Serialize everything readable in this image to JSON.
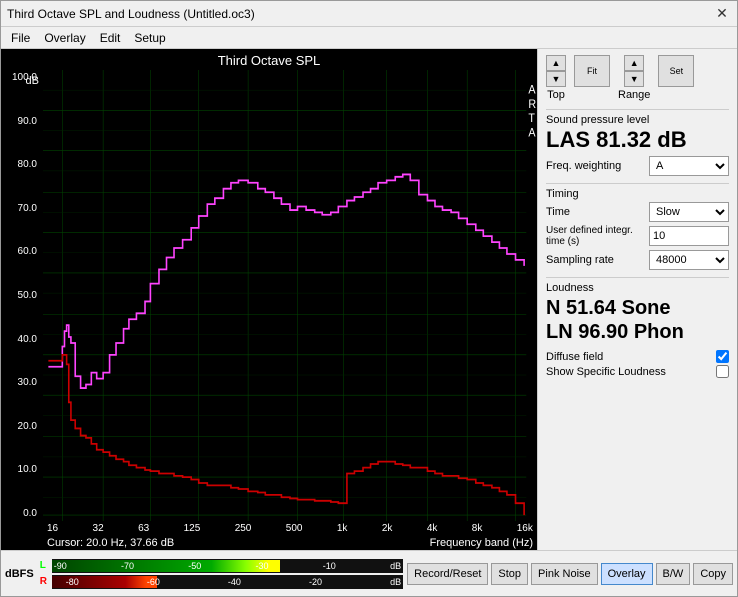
{
  "window": {
    "title": "Third Octave SPL and Loudness (Untitled.oc3)"
  },
  "menu": {
    "items": [
      "File",
      "Overlay",
      "Edit",
      "Setup"
    ]
  },
  "chart": {
    "title": "Third Octave SPL",
    "y_label": "dB",
    "y_ticks": [
      "100.0",
      "90.0",
      "80.0",
      "70.0",
      "60.0",
      "50.0",
      "40.0",
      "30.0",
      "20.0",
      "10.0",
      "0.0"
    ],
    "x_ticks": [
      "16",
      "32",
      "63",
      "125",
      "250",
      "500",
      "1k",
      "2k",
      "4k",
      "8k",
      "16k"
    ],
    "cursor_info": "Cursor:  20.0 Hz, 37.66 dB",
    "freq_label": "Frequency band (Hz)",
    "arta_label": "ARTA"
  },
  "nav": {
    "top_label": "Top",
    "range_label": "Range",
    "fit_label": "Fit",
    "set_label": "Set",
    "up_arrow": "▲",
    "down_arrow": "▼"
  },
  "spl": {
    "section_label": "Sound pressure level",
    "value": "LAS 81.32 dB",
    "freq_weighting_label": "Freq. weighting",
    "freq_weighting_value": "A"
  },
  "timing": {
    "section_label": "Timing",
    "time_label": "Time",
    "time_value": "Slow",
    "user_defined_label": "User defined integr. time (s)",
    "user_defined_value": "10",
    "sampling_rate_label": "Sampling rate",
    "sampling_rate_value": "48000"
  },
  "loudness": {
    "section_label": "Loudness",
    "n_value": "N 51.64 Sone",
    "ln_value": "LN 96.90 Phon",
    "diffuse_field_label": "Diffuse field",
    "diffuse_field_checked": true,
    "show_specific_label": "Show Specific Loudness",
    "show_specific_checked": false
  },
  "bottom": {
    "dbfs_label": "dBFS",
    "l_label": "L",
    "r_label": "R",
    "meter_ticks_l": [
      "-90",
      "-70",
      "-50",
      "-30",
      "-10",
      "dB"
    ],
    "meter_ticks_r": [
      "-80",
      "-60",
      "-40",
      "-20",
      "dB"
    ],
    "buttons": [
      "Record/Reset",
      "Stop",
      "Pink Noise",
      "Overlay",
      "B/W",
      "Copy"
    ]
  }
}
